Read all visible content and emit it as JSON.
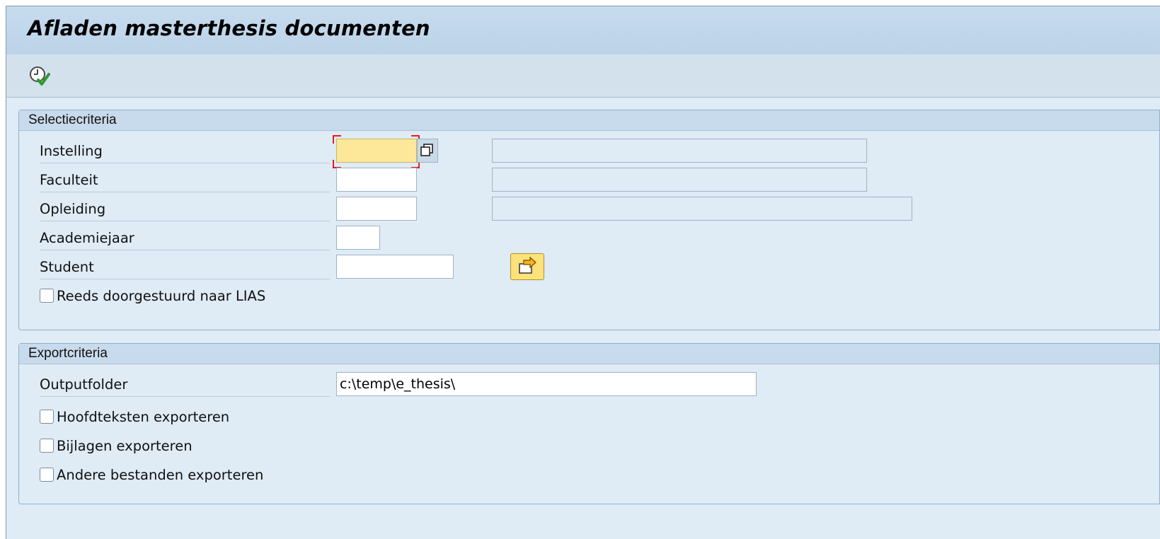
{
  "window": {
    "title": "Afladen masterthesis documenten"
  },
  "toolbar": {
    "execute_icon": "execute-clock-check-icon"
  },
  "selection": {
    "header": "Selectiecriteria",
    "fields": {
      "instelling": {
        "label": "Instelling",
        "value": "",
        "description": ""
      },
      "faculteit": {
        "label": "Faculteit",
        "value": "",
        "description": ""
      },
      "opleiding": {
        "label": "Opleiding",
        "value": "",
        "description": ""
      },
      "academiejaar": {
        "label": "Academiejaar",
        "value": ""
      },
      "student": {
        "label": "Student",
        "value": ""
      }
    },
    "multiple_selection_icon": "arrow-into-box-icon",
    "checkbox_lias": {
      "label": "Reeds doorgestuurd naar LIAS",
      "checked": false
    }
  },
  "export": {
    "header": "Exportcriteria",
    "outputfolder": {
      "label": "Outputfolder",
      "value": "c:\\temp\\e_thesis\\"
    },
    "checkboxes": [
      {
        "label": "Hoofdteksten exporteren",
        "checked": false
      },
      {
        "label": "Bijlagen exporteren",
        "checked": false
      },
      {
        "label": "Andere bestanden exporteren",
        "checked": false
      }
    ]
  },
  "colors": {
    "background": "#dfebf5",
    "title_bar": "#c6dbee",
    "focused_input": "#fde89a",
    "focus_marker": "#e02020",
    "push_button": "#fbe27a"
  }
}
